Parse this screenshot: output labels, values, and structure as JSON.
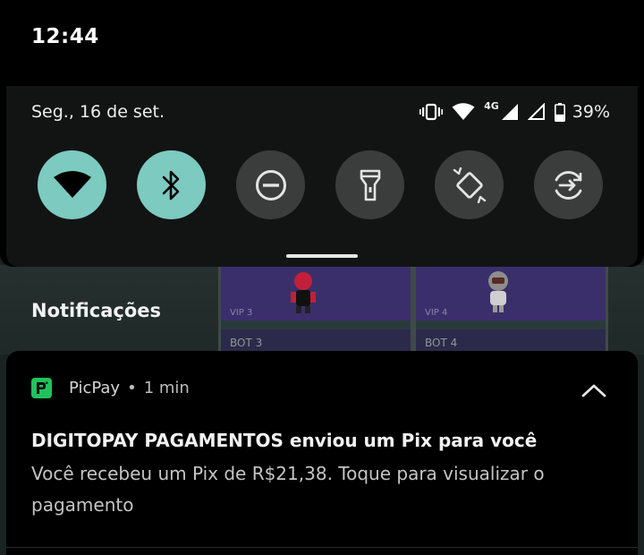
{
  "status_bar": {
    "clock": "12:44",
    "date": "Seg., 16 de set.",
    "network_type": "4G",
    "battery_percent": "39%",
    "battery_level": 0.39,
    "icons": [
      "vibrate-icon",
      "wifi-icon",
      "mobile-signal-icon",
      "sim2-signal-icon",
      "battery-icon"
    ]
  },
  "quick_settings": {
    "accent_color": "#7ccac0",
    "tiles": [
      {
        "name": "wifi",
        "icon": "wifi-icon",
        "active": true
      },
      {
        "name": "bluetooth",
        "icon": "bluetooth-icon",
        "active": true
      },
      {
        "name": "do-not-disturb",
        "icon": "do-not-disturb-icon",
        "active": false
      },
      {
        "name": "flashlight",
        "icon": "flashlight-icon",
        "active": false
      },
      {
        "name": "auto-rotate",
        "icon": "auto-rotate-icon",
        "active": false
      },
      {
        "name": "data-saver",
        "icon": "data-saver-icon",
        "active": false
      }
    ]
  },
  "background_app": {
    "cards": [
      {
        "vip": "VIP 3",
        "bot": "BOT 3"
      },
      {
        "vip": "VIP 4",
        "bot": "BOT 4"
      }
    ]
  },
  "notifications": {
    "header": "Notificações",
    "items": [
      {
        "app_name": "PicPay",
        "separator": "•",
        "time": "1 min",
        "app_color": "#21c25e",
        "title": "DIGITOPAY PAGAMENTOS enviou um Pix para você",
        "body": "Você recebeu um Pix de R$21,38. Toque para visualizar o pagamento"
      }
    ]
  }
}
